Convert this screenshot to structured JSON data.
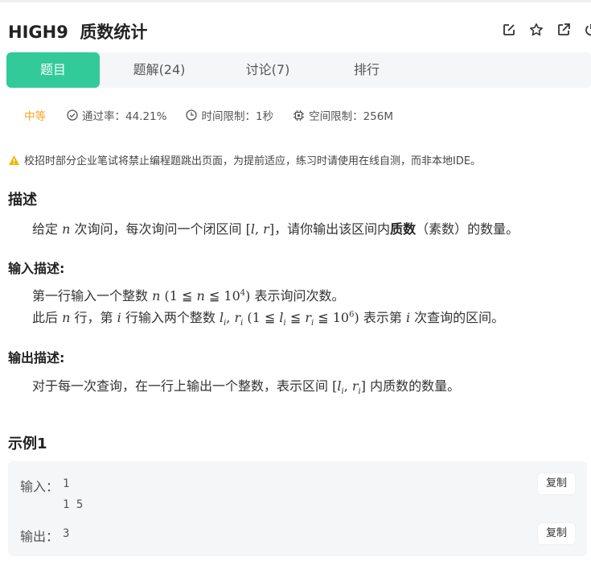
{
  "problem": {
    "id": "HIGH9",
    "name": "质数统计",
    "full_title": "HIGH9  质数统计"
  },
  "header_icons": [
    "edit-icon",
    "star-icon",
    "external-link-icon",
    "power-icon"
  ],
  "tabs": [
    {
      "label": "题目",
      "active": true
    },
    {
      "label": "题解(24)",
      "active": false
    },
    {
      "label": "讨论(7)",
      "active": false
    },
    {
      "label": "排行",
      "active": false
    }
  ],
  "meta": {
    "difficulty": "中等",
    "pass_rate": "通过率：44.21%",
    "time_limit": "时间限制：1秒",
    "space_limit": "空间限制：256M"
  },
  "notice": "校招时部分企业笔试将禁止编程题跳出页面，为提前适应，练习时请使用在线自测，而非本地IDE。",
  "description": {
    "heading": "描述",
    "p1": "给定",
    "p2": "次询问，每次询问一个闭区间",
    "p3": "，请你输出该区间内",
    "bold": "质数",
    "p4": "（素数）的数量。"
  },
  "input_desc": {
    "heading": "输入描述:",
    "l1a": "第一行输入一个整数",
    "l1b": "表示询问次数。",
    "l2a": "此后",
    "l2b": "行，第",
    "l2c": "行输入两个整数",
    "l2d": "表示第",
    "l2e": "次查询的区间。"
  },
  "output_desc": {
    "heading": "输出描述:",
    "t1": "对于每一次查询，在一行上输出一个整数，表示区间",
    "t2": "内质数的数量。"
  },
  "example": {
    "heading": "示例1",
    "input_label": "输入：",
    "input_lines": [
      "1",
      "1 5"
    ],
    "output_label": "输出：",
    "output_value": "3",
    "copy_label": "复制"
  },
  "colors": {
    "accent": "#32ca99",
    "difficulty": "#f6a623",
    "warning": "#f5b400"
  }
}
